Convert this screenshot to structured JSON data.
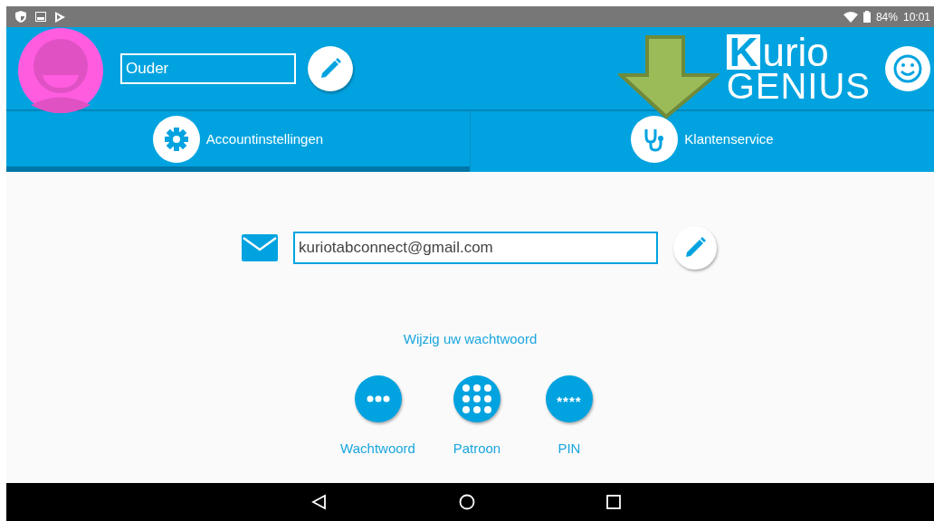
{
  "status_bar": {
    "battery": "84%",
    "time": "10:01"
  },
  "header": {
    "name_value": "Ouder",
    "logo_top": "urio",
    "logo_letter": "K",
    "logo_bottom": "GENIUS"
  },
  "tabs": [
    {
      "label": "Accountinstellingen",
      "kind": "settings",
      "selected": true
    },
    {
      "label": "Klantenservice",
      "kind": "support",
      "selected": false
    }
  ],
  "email": {
    "value": "kuriotabconnect@gmail.com"
  },
  "change_password_link": "Wijzig uw wachtwoord",
  "lock_options": [
    {
      "label": "Wachtwoord",
      "kind": "dots"
    },
    {
      "label": "Patroon",
      "kind": "grid"
    },
    {
      "label": "PIN",
      "kind": "pin",
      "symbol": "****"
    }
  ]
}
